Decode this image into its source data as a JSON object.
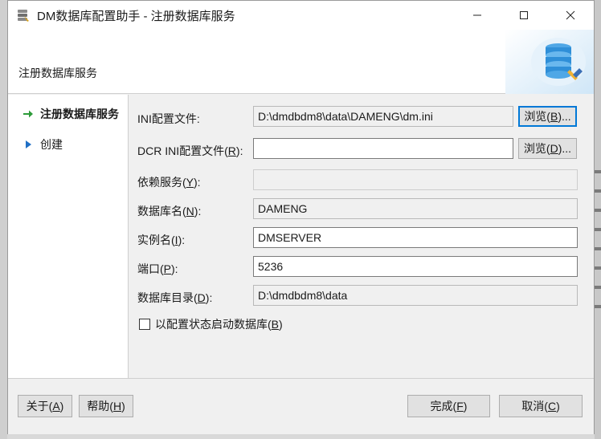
{
  "window": {
    "title": "DM数据库配置助手 - 注册数据库服务",
    "banner_title": "注册数据库服务"
  },
  "nav": {
    "items": [
      {
        "label": "注册数据库服务",
        "icon": "green-arrow-icon",
        "active": true
      },
      {
        "label": "创建",
        "icon": "blue-triangle-icon",
        "active": false
      }
    ]
  },
  "form": {
    "ini_file": {
      "label_pre": "INI配置文件:",
      "value": "D:\\dmdbdm8\\data\\DAMENG\\dm.ini",
      "browse_pre": "浏览(",
      "browse_key": "B",
      "browse_post": ")..."
    },
    "dcr_ini_file": {
      "label_pre": "DCR INI配置文件(",
      "label_key": "R",
      "label_post": "):",
      "value": "",
      "browse_pre": "浏览(",
      "browse_key": "D",
      "browse_post": ")..."
    },
    "depend_service": {
      "label_pre": "依赖服务(",
      "label_key": "Y",
      "label_post": "):",
      "value": ""
    },
    "db_name": {
      "label_pre": "数据库名(",
      "label_key": "N",
      "label_post": "):",
      "value": "DAMENG"
    },
    "instance_name": {
      "label_pre": "实例名(",
      "label_key": "I",
      "label_post": "):",
      "value": "DMSERVER"
    },
    "port": {
      "label_pre": "端口(",
      "label_key": "P",
      "label_post": "):",
      "value": "5236"
    },
    "db_dir": {
      "label_pre": "数据库目录(",
      "label_key": "D",
      "label_post": "):",
      "value": "D:\\dmdbdm8\\data"
    },
    "start_config_state": {
      "label_pre": "以配置状态启动数据库(",
      "label_key": "B",
      "label_post": ")",
      "checked": false
    }
  },
  "footer": {
    "about": {
      "pre": "关于(",
      "key": "A",
      "post": ")"
    },
    "help": {
      "pre": "帮助(",
      "key": "H",
      "post": ")"
    },
    "finish": {
      "pre": "完成(",
      "key": "F",
      "post": ")"
    },
    "cancel": {
      "pre": "取消(",
      "key": "C",
      "post": ")"
    }
  },
  "colors": {
    "accent": "#0078d7",
    "nav_arrow": "#2e9b3a",
    "nav_triangle": "#1f6fc5"
  }
}
